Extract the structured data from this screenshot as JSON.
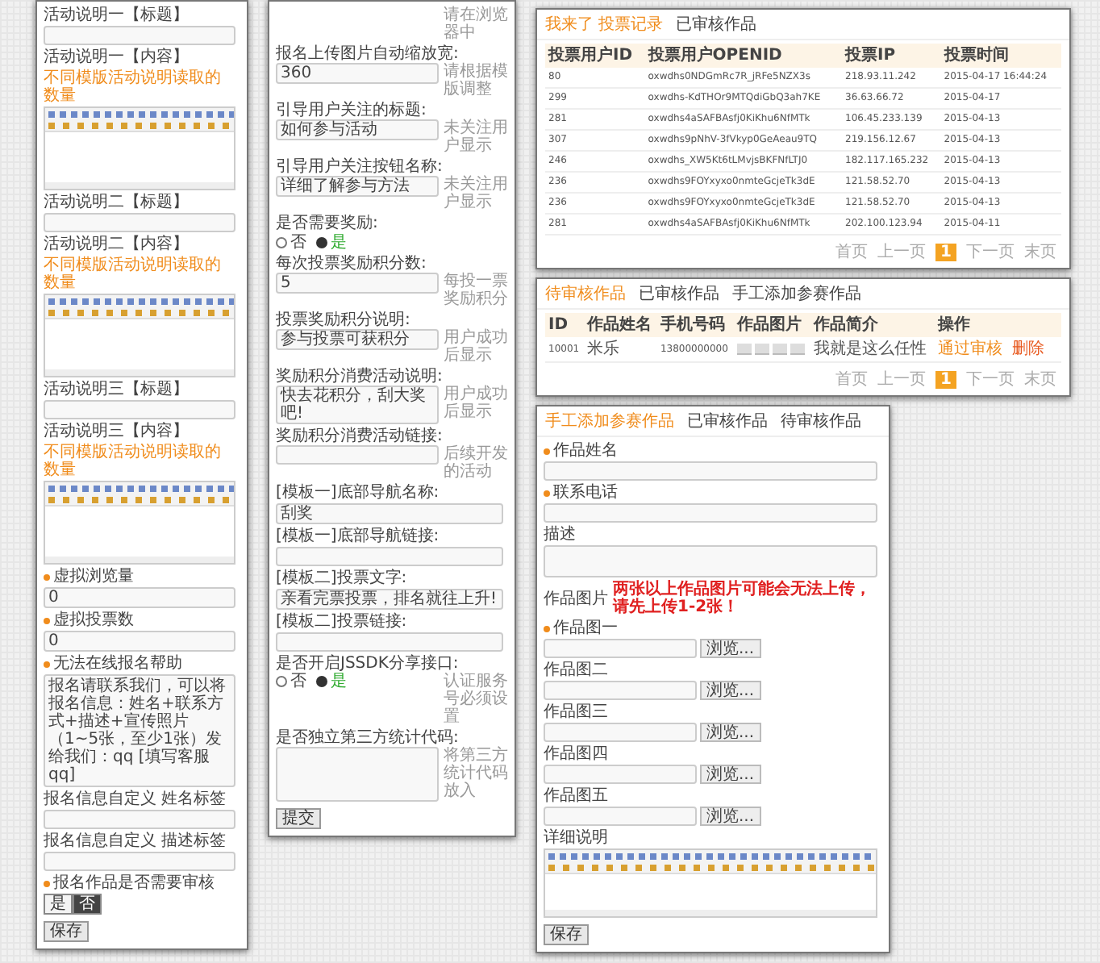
{
  "activity_form": {
    "items": [
      {
        "kind": "field",
        "label": "活动说明一【标题】",
        "required": false
      },
      {
        "kind": "editor",
        "label": "活动说明一【内容】",
        "note": "不同模版活动说明读取的数量",
        "required": false
      },
      {
        "kind": "field",
        "label": "活动说明二【标题】",
        "required": false
      },
      {
        "kind": "editor",
        "label": "活动说明二【内容】",
        "note": "不同模版活动说明读取的数量",
        "required": false
      },
      {
        "kind": "field",
        "label": "活动说明三【标题】",
        "required": false
      },
      {
        "kind": "editor",
        "label": "活动说明三【内容】",
        "note": "不同模版活动说明读取的数量",
        "required": false
      },
      {
        "kind": "field",
        "label": "虚拟浏览量",
        "required": true,
        "value": "0"
      },
      {
        "kind": "field",
        "label": "虚拟投票数",
        "required": true,
        "value": "0"
      },
      {
        "kind": "textarea",
        "label": "无法在线报名帮助",
        "required": true,
        "value": "报名请联系我们，可以将报名信息：姓名+联系方式+描述+宣传照片（1~5张，至少1张）发给我们：qq [填写客服qq]"
      },
      {
        "kind": "field",
        "label": "报名信息自定义 姓名标签",
        "required": false
      },
      {
        "kind": "field",
        "label": "报名信息自定义 描述标签",
        "required": false
      },
      {
        "kind": "toggle",
        "label": "报名作品是否需要审核",
        "required": true,
        "options": [
          {
            "label": "是",
            "selected": false
          },
          {
            "label": "否",
            "selected": true
          }
        ]
      }
    ],
    "button": "保存"
  },
  "settings_form": {
    "items": [
      {
        "kind": "note",
        "note": "请在浏览器中"
      },
      {
        "kind": "field",
        "label": "报名上传图片自动缩放宽:",
        "value": "360",
        "note": "请根据模版调整"
      },
      {
        "kind": "field",
        "label": "引导用户关注的标题:",
        "value": "如何参与活动",
        "note": "未关注用户显示"
      },
      {
        "kind": "field",
        "label": "引导用户关注按钮名称:",
        "value": "详细了解参与方法",
        "note": "未关注用户显示"
      },
      {
        "kind": "radio",
        "label": "是否需要奖励:",
        "options": [
          {
            "label": "否",
            "selected": false
          },
          {
            "label": "是",
            "selected": true
          }
        ]
      },
      {
        "kind": "field",
        "label": "每次投票奖励积分数:",
        "value": "5",
        "note": "每投一票奖励积分"
      },
      {
        "kind": "field",
        "label": "投票奖励积分说明:",
        "value": "参与投票可获积分",
        "note": "用户成功后显示"
      },
      {
        "kind": "field",
        "label": "奖励积分消费活动说明:",
        "value": "快去花积分，刮大奖吧!",
        "note": "用户成功后显示"
      },
      {
        "kind": "field",
        "label": "奖励积分消费活动链接:",
        "note": "后续开发的活动"
      },
      {
        "kind": "field",
        "label": "[模板一]底部导航名称:",
        "value": "刮奖"
      },
      {
        "kind": "field",
        "label": "[模板一]底部导航链接:"
      },
      {
        "kind": "field",
        "label": "[模板二]投票文字:",
        "value": "亲看完票投票，排名就往上升!"
      },
      {
        "kind": "field",
        "label": "[模板二]投票链接:"
      },
      {
        "kind": "radio",
        "label": "是否开启JSSDK分享接口:",
        "options": [
          {
            "label": "否",
            "selected": false
          },
          {
            "label": "是",
            "selected": true
          }
        ],
        "note": "认证服务号必须设置"
      },
      {
        "kind": "textarea",
        "label": "是否独立第三方统计代码:",
        "note": "将第三方统计代码放入"
      }
    ],
    "button": "提交"
  },
  "vote_records": {
    "tabs": [
      {
        "label": "我来了 投票记录",
        "selected": true
      },
      {
        "label": "已审核作品",
        "selected": false
      }
    ],
    "columns": [
      "投票用户ID",
      "投票用户OPENID",
      "投票IP",
      "投票时间"
    ],
    "rows": [
      [
        "80",
        "oxwdhs0NDGmRc7R_jRFe5NZX3s",
        "218.93.11.242",
        "2015-04-17 16:44:24"
      ],
      [
        "299",
        "oxwdhs-KdTHOr9MTQdiGbQ3ah7KE",
        "36.63.66.72",
        "2015-04-17"
      ],
      [
        "281",
        "oxwdhs4aSAFBAsfj0KiKhu6NfMTk",
        "106.45.233.139",
        "2015-04-13"
      ],
      [
        "307",
        "oxwdhs9pNhV-3fVkyp0GeAeau9TQ",
        "219.156.12.67",
        "2015-04-13"
      ],
      [
        "246",
        "oxwdhs_XW5Kt6tLMvjsBKFNfLTJ0",
        "182.117.165.232",
        "2015-04-13"
      ],
      [
        "236",
        "oxwdhs9FOYxyxo0nmteGcjeTk3dE",
        "121.58.52.70",
        "2015-04-13"
      ],
      [
        "236",
        "oxwdhs9FOYxyxo0nmteGcjeTk3dE",
        "121.58.52.70",
        "2015-04-13"
      ],
      [
        "281",
        "oxwdhs4aSAFBAsfj0KiKhu6NfMTk",
        "202.100.123.94",
        "2015-04-11"
      ]
    ],
    "pagination": [
      {
        "label": "首页",
        "selected": false
      },
      {
        "label": "上一页",
        "selected": false
      },
      {
        "label": "1",
        "selected": true
      },
      {
        "label": "下一页",
        "selected": false
      },
      {
        "label": "末页",
        "selected": false
      }
    ]
  },
  "pending_works": {
    "tabs": [
      {
        "label": "待审核作品",
        "selected": true
      },
      {
        "label": "已审核作品",
        "selected": false
      },
      {
        "label": "手工添加参赛作品",
        "selected": false
      }
    ],
    "columns": [
      "ID",
      "作品姓名",
      "手机号码",
      "作品图片",
      "作品简介",
      "操作"
    ],
    "rows": [
      {
        "id": "10001",
        "name": "米乐",
        "phone": "13800000000",
        "images": [
          {
            "kind": "photo"
          },
          {
            "kind": "photo"
          },
          {
            "kind": "photo"
          },
          {
            "kind": "photo"
          }
        ],
        "intro": "我就是这么任性",
        "actions": [
          "通过审核",
          "删除"
        ]
      }
    ],
    "pagination": [
      {
        "label": "首页",
        "selected": false
      },
      {
        "label": "上一页",
        "selected": false
      },
      {
        "label": "1",
        "selected": true
      },
      {
        "label": "下一页",
        "selected": false
      },
      {
        "label": "末页",
        "selected": false
      }
    ]
  },
  "add_work_form": {
    "tabs": [
      {
        "label": "手工添加参赛作品",
        "selected": true
      },
      {
        "label": "已审核作品",
        "selected": false
      },
      {
        "label": "待审核作品",
        "selected": false
      }
    ],
    "items": [
      {
        "kind": "field",
        "label": "作品姓名",
        "required": true
      },
      {
        "kind": "field",
        "label": "联系电话",
        "required": true
      },
      {
        "kind": "textarea",
        "label": "描述",
        "required": false
      },
      {
        "kind": "notice",
        "label": "作品图片",
        "text": "两张以上作品图片可能会无法上传，请先上传1-2张！",
        "required": false
      },
      {
        "kind": "file",
        "label": "作品图一",
        "required": true,
        "button": "浏览..."
      },
      {
        "kind": "file",
        "label": "作品图二",
        "required": false,
        "button": "浏览..."
      },
      {
        "kind": "file",
        "label": "作品图三",
        "required": false,
        "button": "浏览..."
      },
      {
        "kind": "file",
        "label": "作品图四",
        "required": false,
        "button": "浏览..."
      },
      {
        "kind": "file",
        "label": "作品图五",
        "required": false,
        "button": "浏览..."
      },
      {
        "kind": "editor",
        "label": "详细说明",
        "required": false
      }
    ],
    "button": "保存"
  }
}
